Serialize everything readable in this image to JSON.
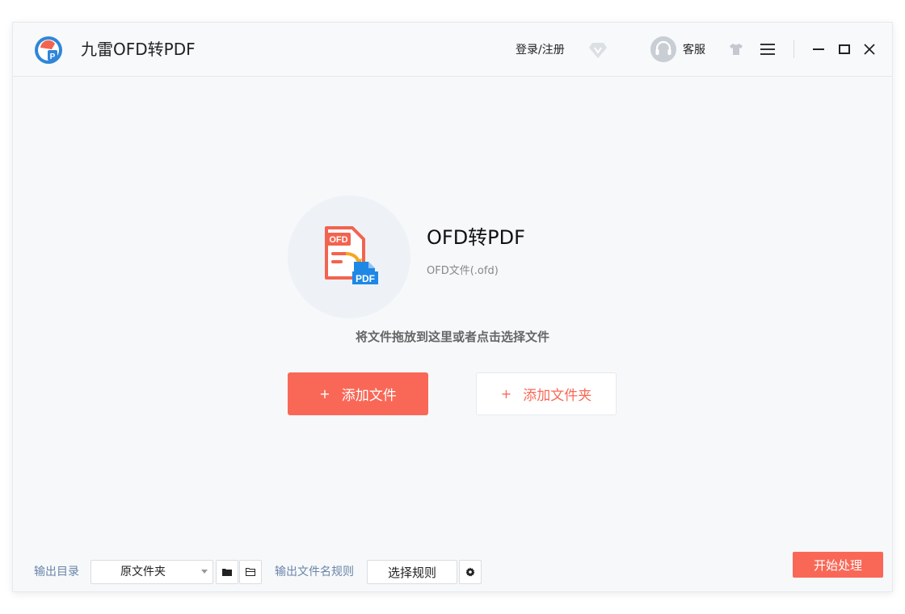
{
  "app": {
    "title": "九雷OFD转PDF"
  },
  "titlebar": {
    "login_label": "登录/注册",
    "support_label": "客服",
    "icons": [
      "app-logo",
      "vip-diamond-icon",
      "headset-icon",
      "skin-shirt-icon",
      "menu-icon",
      "minimize-icon",
      "maximize-icon",
      "close-icon"
    ]
  },
  "feature": {
    "title": "OFD转PDF",
    "subtitle": "OFD文件(.ofd)",
    "icon_badge_top": "OFD",
    "icon_badge_bottom": "PDF"
  },
  "main": {
    "drop_hint": "将文件拖放到这里或者点击选择文件",
    "add_file_label": "添加文件",
    "add_folder_label": "添加文件夹",
    "plus_symbol": "+"
  },
  "bottom": {
    "output_dir_label": "输出目录",
    "output_dir_value": "原文件夹",
    "filename_rule_label": "输出文件名规则",
    "filename_rule_value": "选择规则",
    "start_label": "开始处理"
  },
  "colors": {
    "accent": "#f96857",
    "window_bg": "#f6f8fa",
    "label_blue": "#6a85a8",
    "pdf_blue": "#1e88e5"
  }
}
